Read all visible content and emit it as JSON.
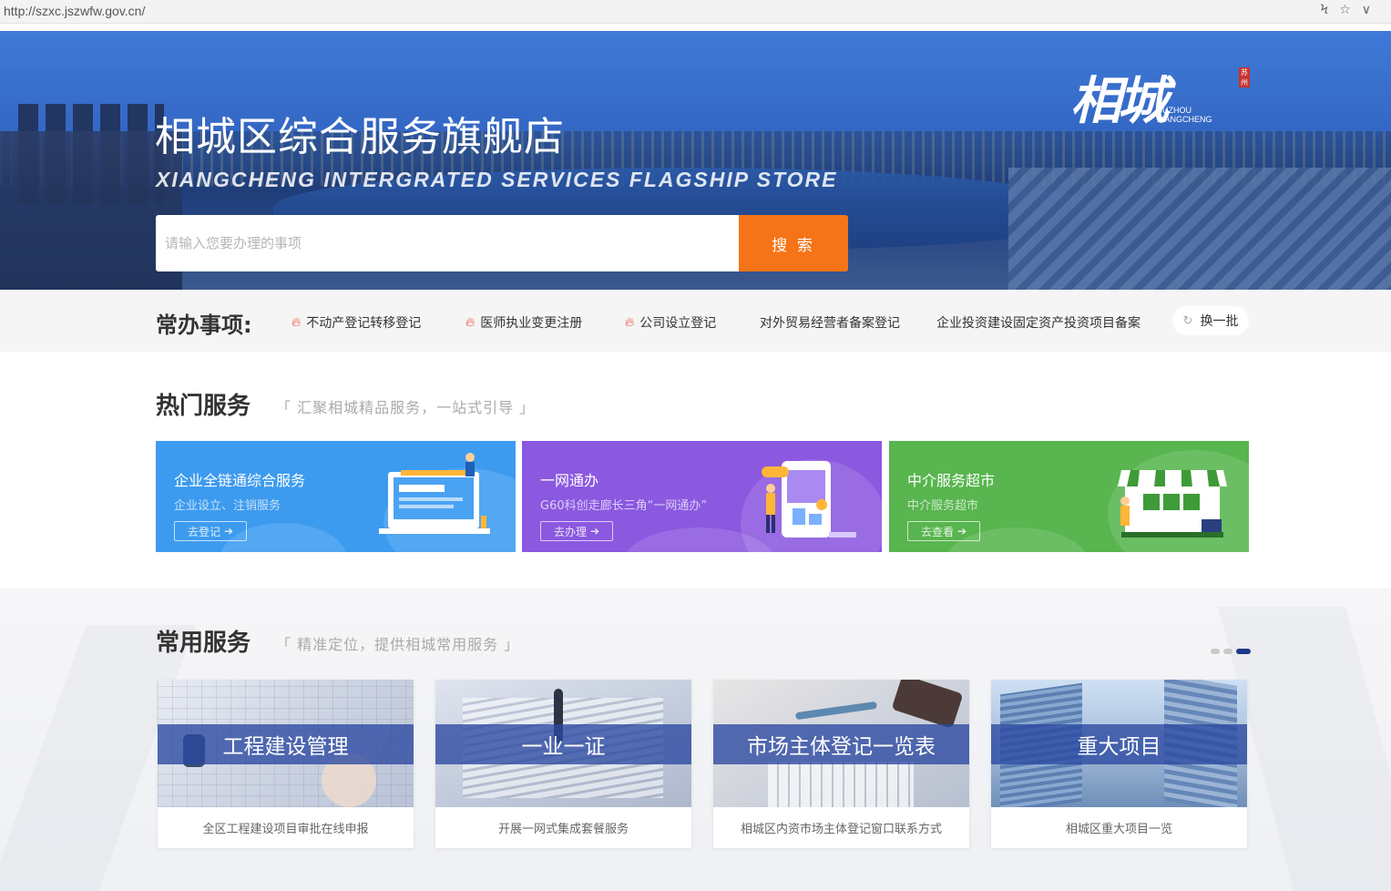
{
  "browser": {
    "url": "http://szxc.jszwfw.gov.cn/"
  },
  "hero": {
    "title": "相城区综合服务旗舰店",
    "subtitle": "XIANGCHENG INTERGRATED SERVICES FLAGSHIP STORE",
    "search_placeholder": "请输入您要办理的事项",
    "search_button": "搜 索",
    "logo_main": "相城",
    "logo_seal": "苏州",
    "logo_en_1": "SUZHOU",
    "logo_en_2": "XIANGCHENG"
  },
  "frequent": {
    "title": "常办事项:",
    "items": [
      {
        "label": "不动产登记转移登记",
        "hot": true
      },
      {
        "label": "医师执业变更注册",
        "hot": true
      },
      {
        "label": "公司设立登记",
        "hot": true
      },
      {
        "label": "对外贸易经营者备案登记",
        "hot": false
      },
      {
        "label": "企业投资建设固定资产投资项目备案",
        "hot": false
      }
    ],
    "refresh_label": "换一批"
  },
  "hot_services": {
    "title": "热门服务",
    "subtitle": "「 汇聚相城精品服务，一站式引导 」",
    "cards": [
      {
        "title": "企业全链通综合服务",
        "desc": "企业设立、注销服务",
        "button": "去登记",
        "color": "#3d9bef"
      },
      {
        "title": "一网通办",
        "desc": "G60科创走廊长三角“一网通办”",
        "button": "去办理",
        "color": "#8b58e0"
      },
      {
        "title": "中介服务超市",
        "desc": "中介服务超市",
        "button": "去查看",
        "color": "#58b54f"
      }
    ]
  },
  "common_services": {
    "title": "常用服务",
    "subtitle": "「 精准定位，提供相城常用服务 」",
    "cards": [
      {
        "title": "工程建设管理",
        "caption": "全区工程建设项目审批在线申报"
      },
      {
        "title": "一业一证",
        "caption": "开展一网式集成套餐服务"
      },
      {
        "title": "市场主体登记一览表",
        "caption": "相城区内资市场主体登记窗口联系方式"
      },
      {
        "title": "重大项目",
        "caption": "相城区重大项目一览"
      }
    ]
  }
}
